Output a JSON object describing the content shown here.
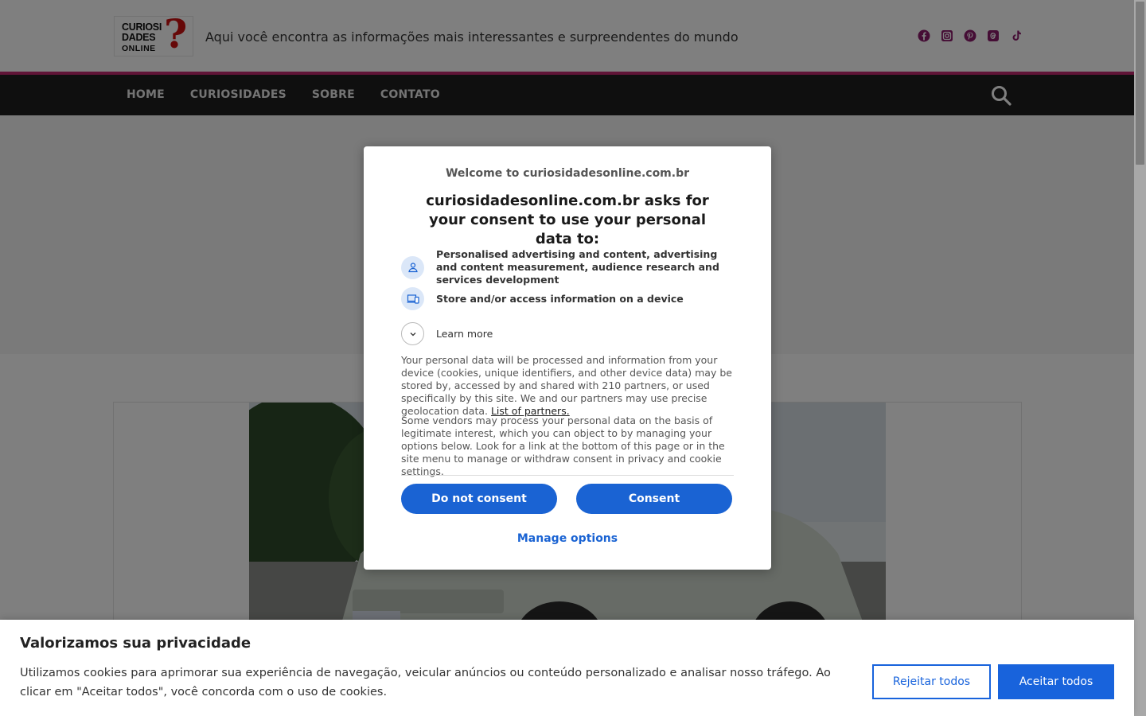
{
  "header": {
    "logo": {
      "line1": "CURIOSI",
      "line2": "DADES",
      "line3": "ONLINE",
      "mark": "?"
    },
    "tagline": "Aqui você encontra as informações mais interessantes e surpreendentes do mundo",
    "social_icons": [
      "facebook-icon",
      "instagram-icon",
      "pinterest-icon",
      "threads-icon",
      "tiktok-icon"
    ],
    "social_color": "#8b1a6b",
    "accent_color": "#c0286e"
  },
  "nav": {
    "items": [
      "HOME",
      "CURIOSIDADES",
      "SOBRE",
      "CONTATO"
    ],
    "search_icon": "search-icon"
  },
  "consent_modal": {
    "welcome": "Welcome to curiosidadesonline.com.br",
    "title": "curiosidadesonline.com.br asks for your consent to use your personal data to:",
    "purposes": [
      {
        "icon": "person-icon",
        "text": "Personalised advertising and content, advertising and content measurement, audience research and services development"
      },
      {
        "icon": "devices-icon",
        "text": "Store and/or access information on a device"
      }
    ],
    "learn_more": "Learn more",
    "body1": "Your personal data will be processed and information from your device (cookies, unique identifiers, and other device data) may be stored by, accessed by and shared with 210 partners, or used specifically by this site. We and our partners may use precise geolocation data.",
    "partners_link": "List of partners.",
    "body2": "Some vendors may process your personal data on the basis of legitimate interest, which you can object to by managing your options below. Look for a link at the bottom of this page or in the site menu to manage or withdraw consent in privacy and cookie settings.",
    "do_not_consent": "Do not consent",
    "consent": "Consent",
    "manage_options": "Manage options",
    "button_color": "#1a63d3"
  },
  "cookie_bar": {
    "title": "Valorizamos sua privacidade",
    "text": "Utilizamos cookies para aprimorar sua experiência de navegação, veicular anúncios ou conteúdo personalizado e analisar nosso tráfego. Ao clicar em \"Aceitar todos\", você concorda com o uso de cookies.",
    "reject": "Rejeitar todos",
    "accept": "Aceitar todos",
    "button_color": "#1863dc"
  }
}
